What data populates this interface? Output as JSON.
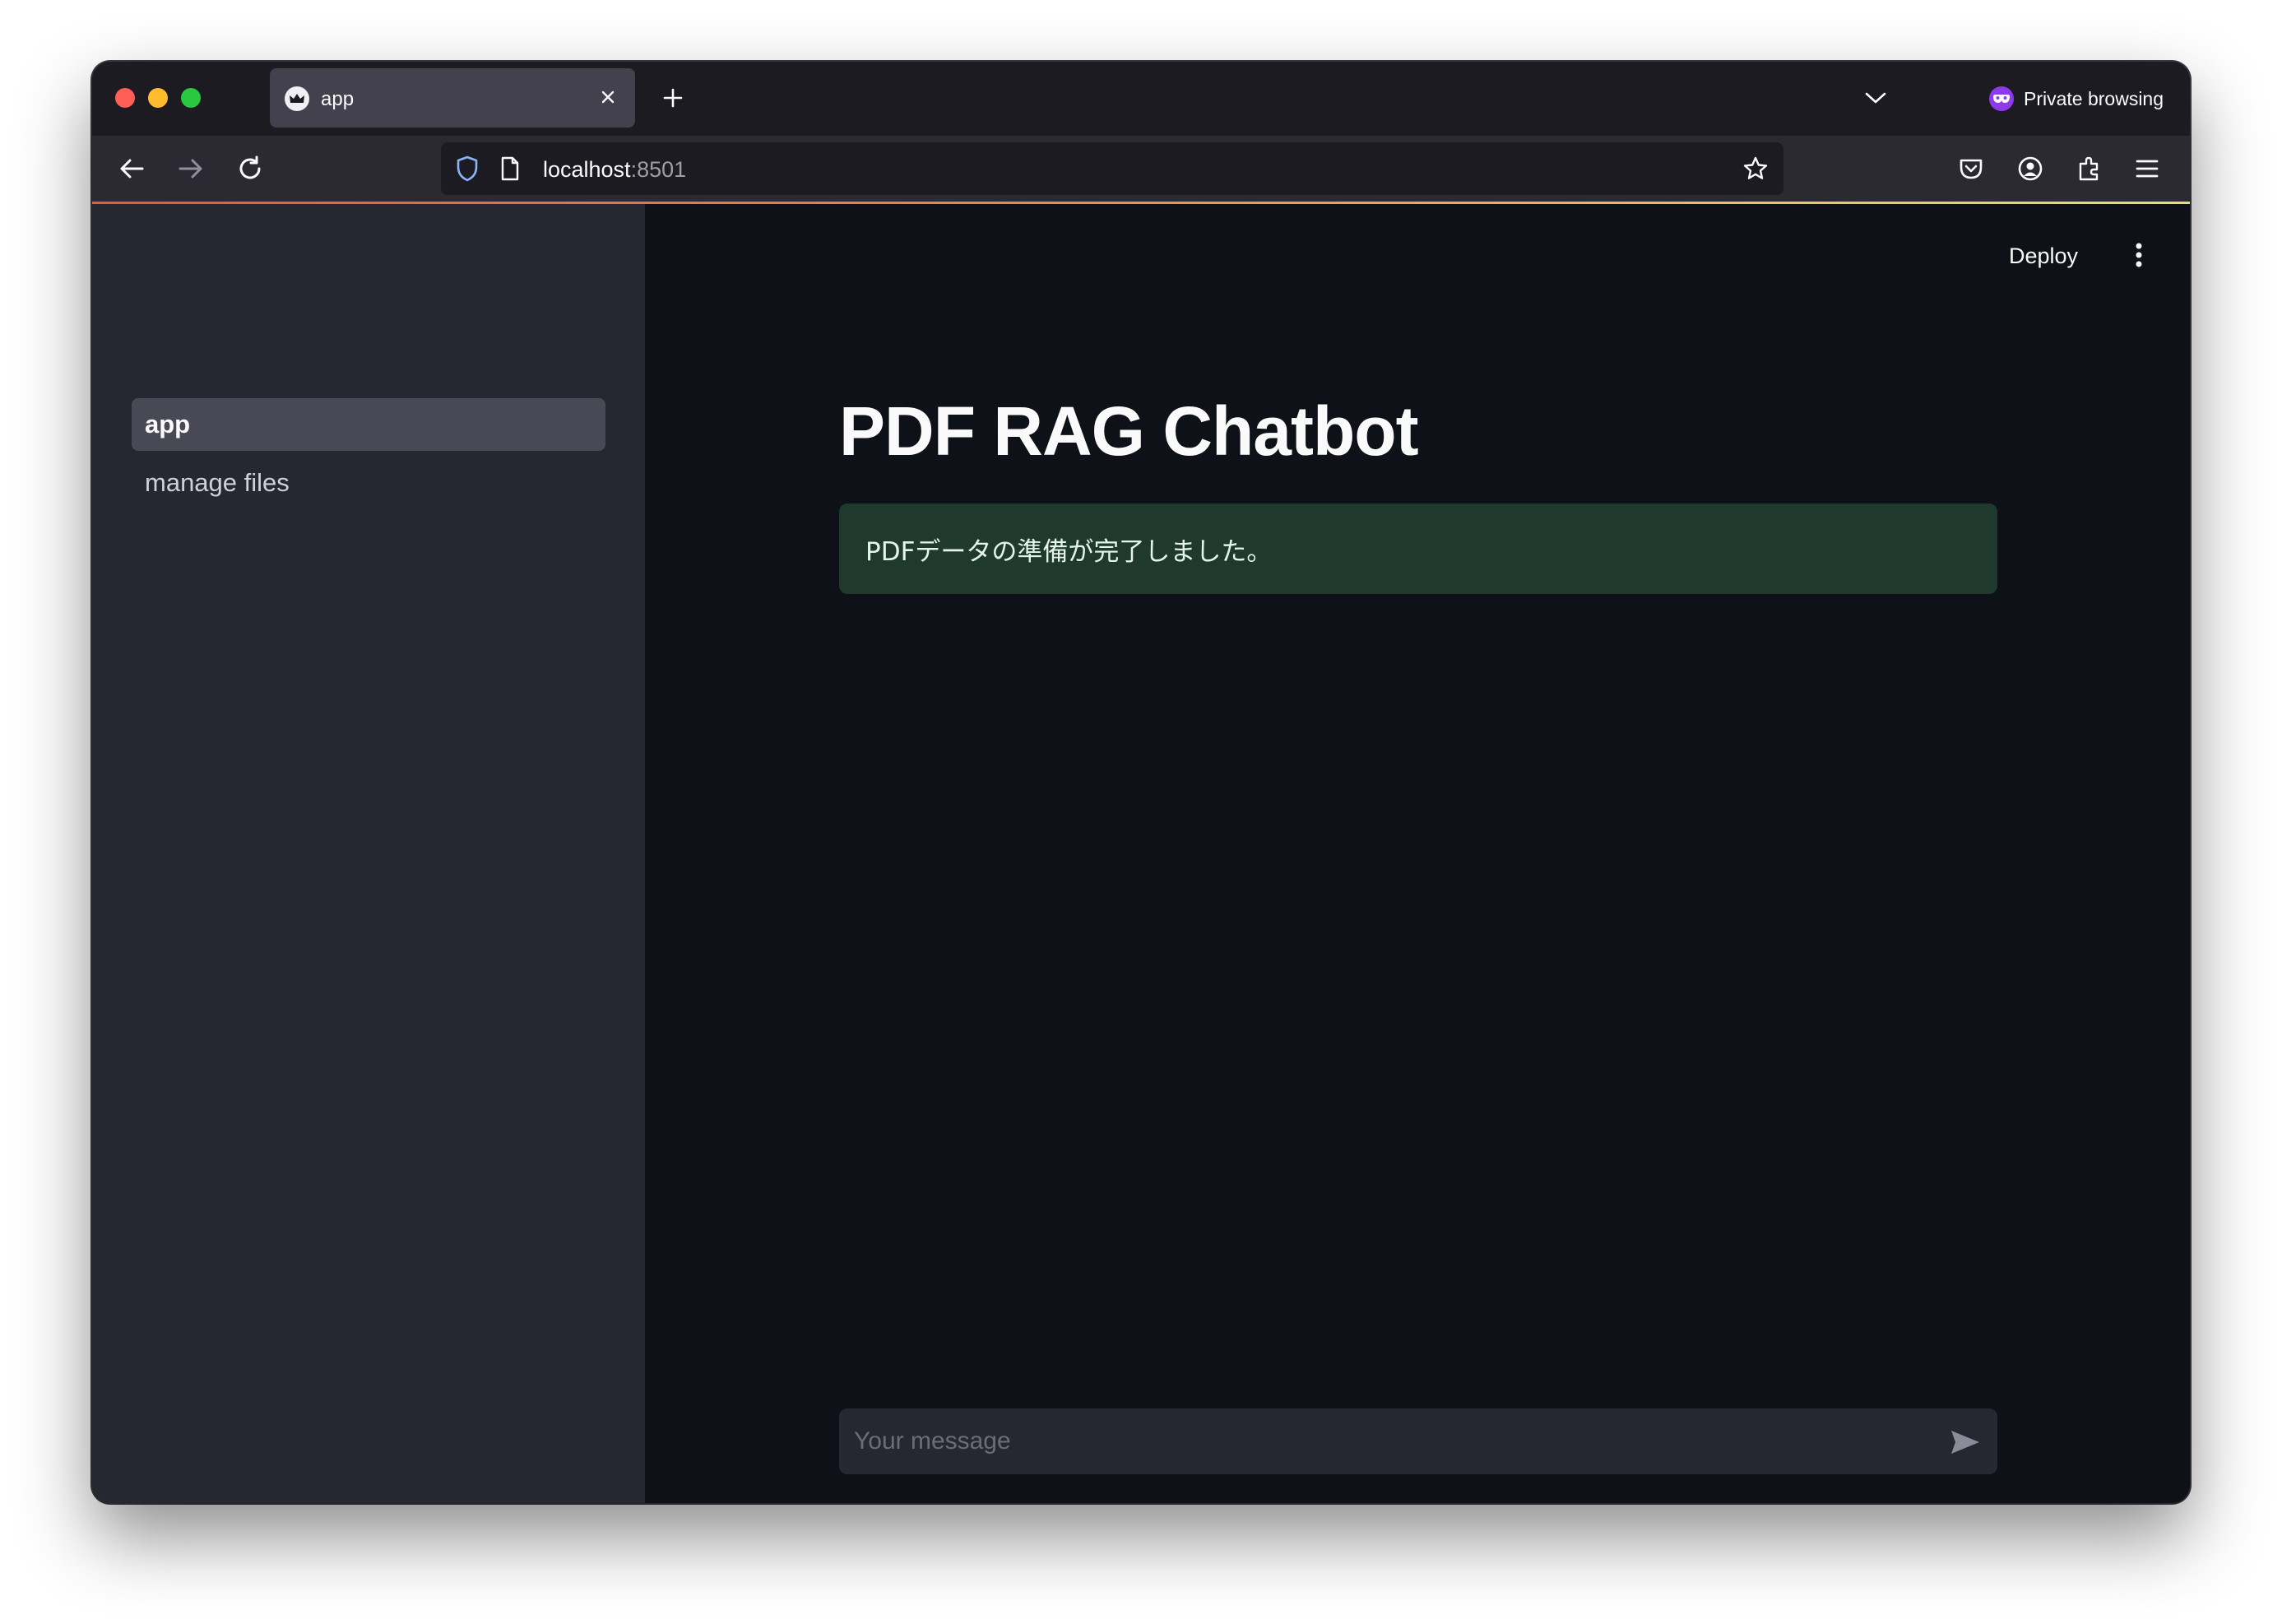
{
  "browser": {
    "tab_title": "app",
    "private_label": "Private browsing",
    "url_host": "localhost",
    "url_port": ":8501"
  },
  "sidebar": {
    "items": [
      {
        "label": "app",
        "active": true
      },
      {
        "label": "manage files",
        "active": false
      }
    ]
  },
  "header": {
    "deploy_label": "Deploy"
  },
  "main": {
    "title": "PDF RAG Chatbot",
    "alert_text": "PDFデータの準備が完了しました。"
  },
  "chat": {
    "placeholder": "Your message"
  },
  "colors": {
    "sidebar_bg": "#262730",
    "main_bg": "#0e1117",
    "alert_bg": "#1f3a2c",
    "active_item_bg": "#484955"
  }
}
